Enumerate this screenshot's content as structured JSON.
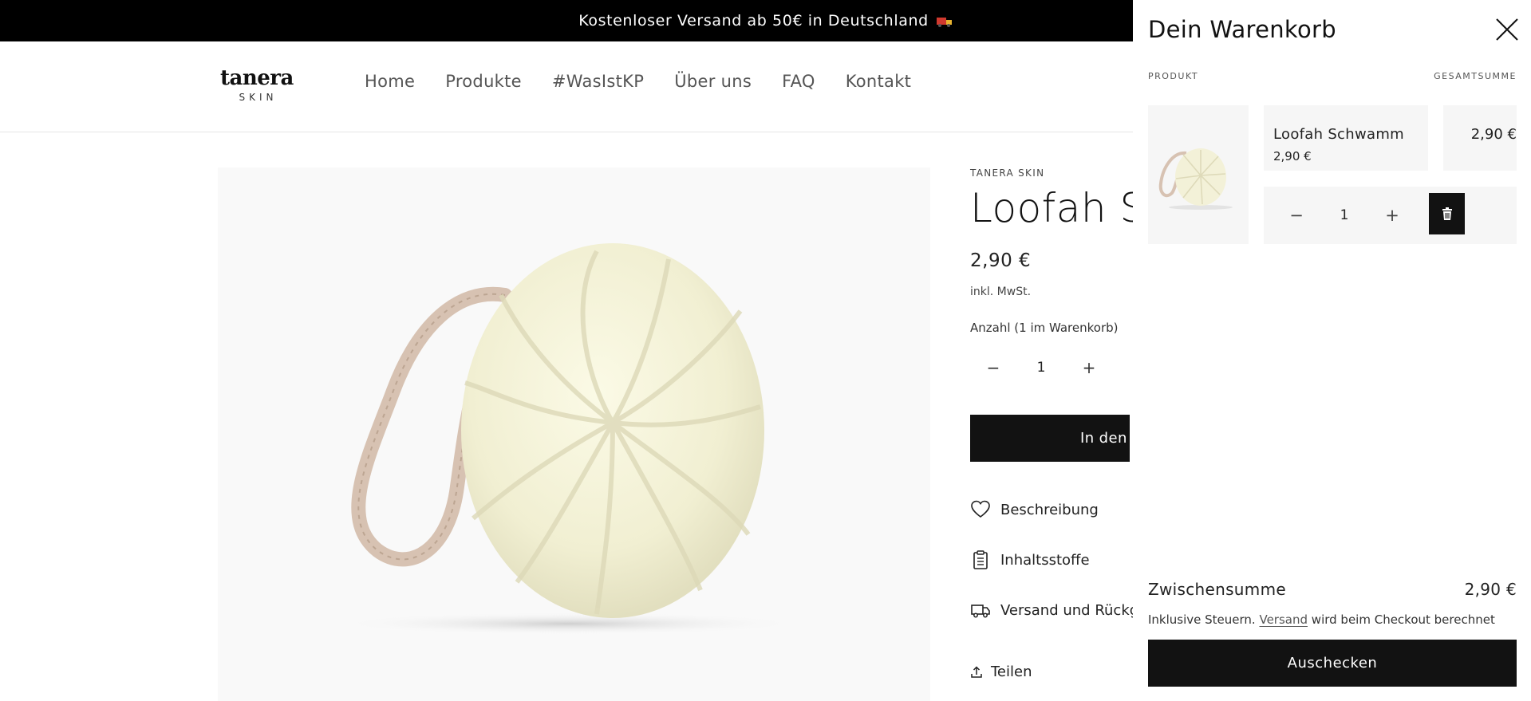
{
  "announcement": {
    "text": "Kostenloser Versand ab 50€ in Deutschland"
  },
  "header": {
    "logo": {
      "wordmark": "tanera",
      "sub": "SKIN"
    },
    "nav": [
      "Home",
      "Produkte",
      "#WasIstKP",
      "Über uns",
      "FAQ",
      "Kontakt"
    ]
  },
  "product": {
    "vendor": "TANERA SKIN",
    "title": "Loofah Sc",
    "price": "2,90 €",
    "tax": "inkl. MwSt.",
    "quantity_label": "Anzahl (1 im Warenkorb)",
    "quantity": "1",
    "add_to_cart": "In den W",
    "accordions": [
      "Beschreibung",
      "Inhaltsstoffe",
      "Versand und Rückga"
    ],
    "share": "Teilen"
  },
  "cart": {
    "title": "Dein Warenkorb",
    "col_product": "PRODUKT",
    "col_total": "GESAMTSUMME",
    "item": {
      "name": "Loofah Schwamm",
      "price": "2,90 €",
      "total": "2,90 €",
      "quantity": "1"
    },
    "subtotal_label": "Zwischensumme",
    "subtotal_value": "2,90 €",
    "tax_note_pre": "Inklusive Steuern.",
    "tax_note_link": "Versand",
    "tax_note_post": "wird beim Checkout berechnet",
    "checkout": "Auschecken"
  }
}
